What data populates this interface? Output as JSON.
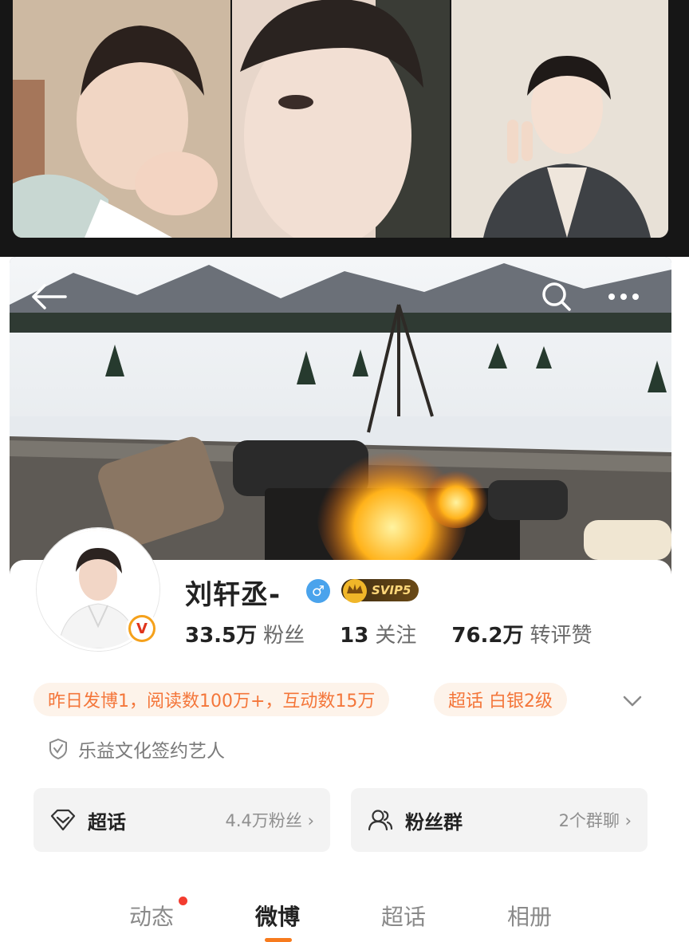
{
  "profile": {
    "username": "刘轩丞-",
    "gender_icon": "male-icon",
    "svip_label": "SVIP5",
    "stats": [
      {
        "value": "33.5万",
        "label": "粉丝"
      },
      {
        "value": "13",
        "label": "关注"
      },
      {
        "value": "76.2万",
        "label": "转评赞"
      }
    ],
    "activity_chip": "昨日发博1，阅读数100万+，互动数15万",
    "supertopic_chip": "超话 白银2级",
    "signature": "乐益文化签约艺人",
    "verified_label": "V"
  },
  "cards": {
    "supertopic": {
      "title": "超话",
      "sub": "4.4万粉丝 ›"
    },
    "fan_group": {
      "title": "粉丝群",
      "sub": "2个群聊 ›"
    }
  },
  "tabs": [
    {
      "label": "动态"
    },
    {
      "label": "微博"
    },
    {
      "label": "超话"
    },
    {
      "label": "相册"
    }
  ],
  "colors": {
    "accent_orange": "#f4763a",
    "chip_bg": "#fdf3ea",
    "gender_blue": "#4aa3ec",
    "tab_underline": "#f77b1e",
    "notification_red": "#f33c2f"
  }
}
